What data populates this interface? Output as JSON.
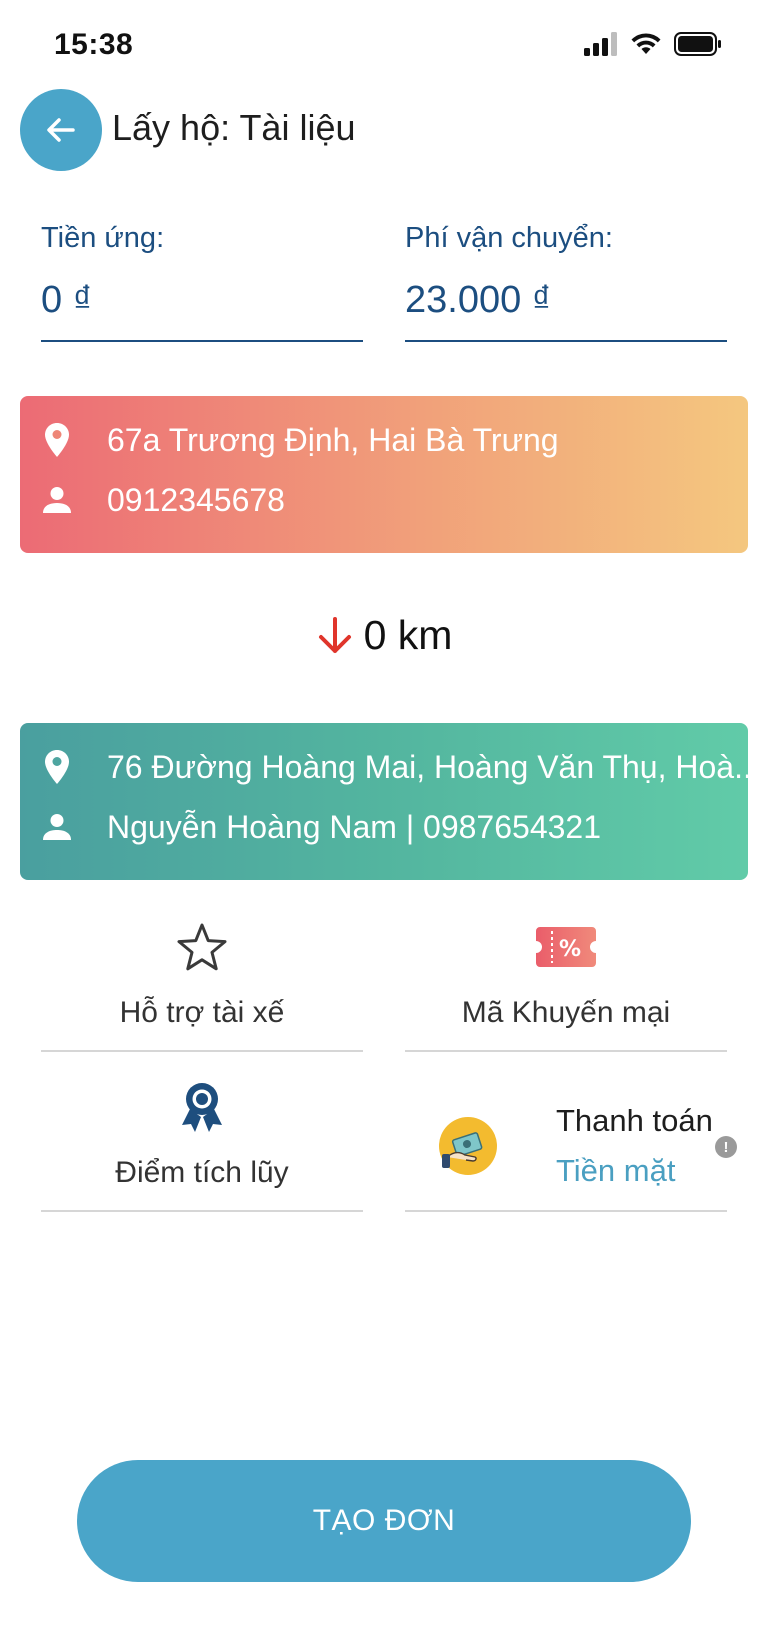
{
  "status_bar": {
    "time": "15:38",
    "icons": [
      "cellular-signal-icon",
      "wifi-icon",
      "battery-icon"
    ]
  },
  "header": {
    "back_icon": "arrow-left-icon",
    "title": "Lấy hộ: Tài liệu"
  },
  "fees": {
    "advance_label": "Tiền ứng:",
    "advance_value": "0 ₫",
    "shipping_label": "Phí vận chuyển:",
    "shipping_value": "23.000 ₫"
  },
  "pickup": {
    "address": "67a Trương Định, Hai Bà Trưng",
    "contact": "0912345678",
    "icons": [
      "location-pin-icon",
      "person-icon"
    ],
    "gradient": [
      "#ec6b75",
      "#f4c77f"
    ]
  },
  "distance": {
    "icon": "arrow-down-icon",
    "text": "0 km"
  },
  "dropoff": {
    "address": "76 Đường Hoàng Mai, Hoàng Văn Thụ, Hoà...",
    "contact": "Nguyễn Hoàng Nam | 0987654321",
    "icons": [
      "location-pin-icon",
      "person-icon"
    ],
    "gradient": [
      "#4a9f9f",
      "#61cba8"
    ]
  },
  "options": {
    "driver_support": {
      "label": "Hỗ trợ tài xế",
      "icon": "star-outline-icon"
    },
    "promo_code": {
      "label": "Mã Khuyến mại",
      "icon": "coupon-percent-icon"
    },
    "loyalty_points": {
      "label": "Điểm tích lũy",
      "icon": "award-ribbon-icon"
    },
    "payment": {
      "title": "Thanh toán",
      "method": "Tiền mặt",
      "icon": "cash-hand-icon",
      "info_icon": "info-icon",
      "info_mark": "!"
    }
  },
  "actions": {
    "create_label": "TẠO ĐƠN"
  },
  "colors": {
    "primary": "#4aa5c9",
    "field_text": "#1c4e80",
    "payment_method": "#4a9fc1",
    "distance_arrow": "#e0352b"
  }
}
